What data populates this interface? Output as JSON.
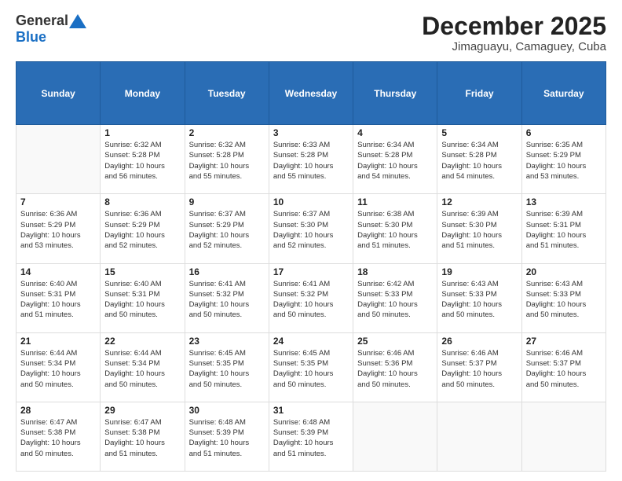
{
  "header": {
    "logo": {
      "general": "General",
      "blue": "Blue"
    },
    "title": "December 2025",
    "location": "Jimaguayu, Camaguey, Cuba"
  },
  "weekdays": [
    "Sunday",
    "Monday",
    "Tuesday",
    "Wednesday",
    "Thursday",
    "Friday",
    "Saturday"
  ],
  "weeks": [
    [
      {
        "day": "",
        "info": ""
      },
      {
        "day": "1",
        "info": "Sunrise: 6:32 AM\nSunset: 5:28 PM\nDaylight: 10 hours\nand 56 minutes."
      },
      {
        "day": "2",
        "info": "Sunrise: 6:32 AM\nSunset: 5:28 PM\nDaylight: 10 hours\nand 55 minutes."
      },
      {
        "day": "3",
        "info": "Sunrise: 6:33 AM\nSunset: 5:28 PM\nDaylight: 10 hours\nand 55 minutes."
      },
      {
        "day": "4",
        "info": "Sunrise: 6:34 AM\nSunset: 5:28 PM\nDaylight: 10 hours\nand 54 minutes."
      },
      {
        "day": "5",
        "info": "Sunrise: 6:34 AM\nSunset: 5:28 PM\nDaylight: 10 hours\nand 54 minutes."
      },
      {
        "day": "6",
        "info": "Sunrise: 6:35 AM\nSunset: 5:29 PM\nDaylight: 10 hours\nand 53 minutes."
      }
    ],
    [
      {
        "day": "7",
        "info": "Sunrise: 6:36 AM\nSunset: 5:29 PM\nDaylight: 10 hours\nand 53 minutes."
      },
      {
        "day": "8",
        "info": "Sunrise: 6:36 AM\nSunset: 5:29 PM\nDaylight: 10 hours\nand 52 minutes."
      },
      {
        "day": "9",
        "info": "Sunrise: 6:37 AM\nSunset: 5:29 PM\nDaylight: 10 hours\nand 52 minutes."
      },
      {
        "day": "10",
        "info": "Sunrise: 6:37 AM\nSunset: 5:30 PM\nDaylight: 10 hours\nand 52 minutes."
      },
      {
        "day": "11",
        "info": "Sunrise: 6:38 AM\nSunset: 5:30 PM\nDaylight: 10 hours\nand 51 minutes."
      },
      {
        "day": "12",
        "info": "Sunrise: 6:39 AM\nSunset: 5:30 PM\nDaylight: 10 hours\nand 51 minutes."
      },
      {
        "day": "13",
        "info": "Sunrise: 6:39 AM\nSunset: 5:31 PM\nDaylight: 10 hours\nand 51 minutes."
      }
    ],
    [
      {
        "day": "14",
        "info": "Sunrise: 6:40 AM\nSunset: 5:31 PM\nDaylight: 10 hours\nand 51 minutes."
      },
      {
        "day": "15",
        "info": "Sunrise: 6:40 AM\nSunset: 5:31 PM\nDaylight: 10 hours\nand 50 minutes."
      },
      {
        "day": "16",
        "info": "Sunrise: 6:41 AM\nSunset: 5:32 PM\nDaylight: 10 hours\nand 50 minutes."
      },
      {
        "day": "17",
        "info": "Sunrise: 6:41 AM\nSunset: 5:32 PM\nDaylight: 10 hours\nand 50 minutes."
      },
      {
        "day": "18",
        "info": "Sunrise: 6:42 AM\nSunset: 5:33 PM\nDaylight: 10 hours\nand 50 minutes."
      },
      {
        "day": "19",
        "info": "Sunrise: 6:43 AM\nSunset: 5:33 PM\nDaylight: 10 hours\nand 50 minutes."
      },
      {
        "day": "20",
        "info": "Sunrise: 6:43 AM\nSunset: 5:33 PM\nDaylight: 10 hours\nand 50 minutes."
      }
    ],
    [
      {
        "day": "21",
        "info": "Sunrise: 6:44 AM\nSunset: 5:34 PM\nDaylight: 10 hours\nand 50 minutes."
      },
      {
        "day": "22",
        "info": "Sunrise: 6:44 AM\nSunset: 5:34 PM\nDaylight: 10 hours\nand 50 minutes."
      },
      {
        "day": "23",
        "info": "Sunrise: 6:45 AM\nSunset: 5:35 PM\nDaylight: 10 hours\nand 50 minutes."
      },
      {
        "day": "24",
        "info": "Sunrise: 6:45 AM\nSunset: 5:35 PM\nDaylight: 10 hours\nand 50 minutes."
      },
      {
        "day": "25",
        "info": "Sunrise: 6:46 AM\nSunset: 5:36 PM\nDaylight: 10 hours\nand 50 minutes."
      },
      {
        "day": "26",
        "info": "Sunrise: 6:46 AM\nSunset: 5:37 PM\nDaylight: 10 hours\nand 50 minutes."
      },
      {
        "day": "27",
        "info": "Sunrise: 6:46 AM\nSunset: 5:37 PM\nDaylight: 10 hours\nand 50 minutes."
      }
    ],
    [
      {
        "day": "28",
        "info": "Sunrise: 6:47 AM\nSunset: 5:38 PM\nDaylight: 10 hours\nand 50 minutes."
      },
      {
        "day": "29",
        "info": "Sunrise: 6:47 AM\nSunset: 5:38 PM\nDaylight: 10 hours\nand 51 minutes."
      },
      {
        "day": "30",
        "info": "Sunrise: 6:48 AM\nSunset: 5:39 PM\nDaylight: 10 hours\nand 51 minutes."
      },
      {
        "day": "31",
        "info": "Sunrise: 6:48 AM\nSunset: 5:39 PM\nDaylight: 10 hours\nand 51 minutes."
      },
      {
        "day": "",
        "info": ""
      },
      {
        "day": "",
        "info": ""
      },
      {
        "day": "",
        "info": ""
      }
    ]
  ]
}
